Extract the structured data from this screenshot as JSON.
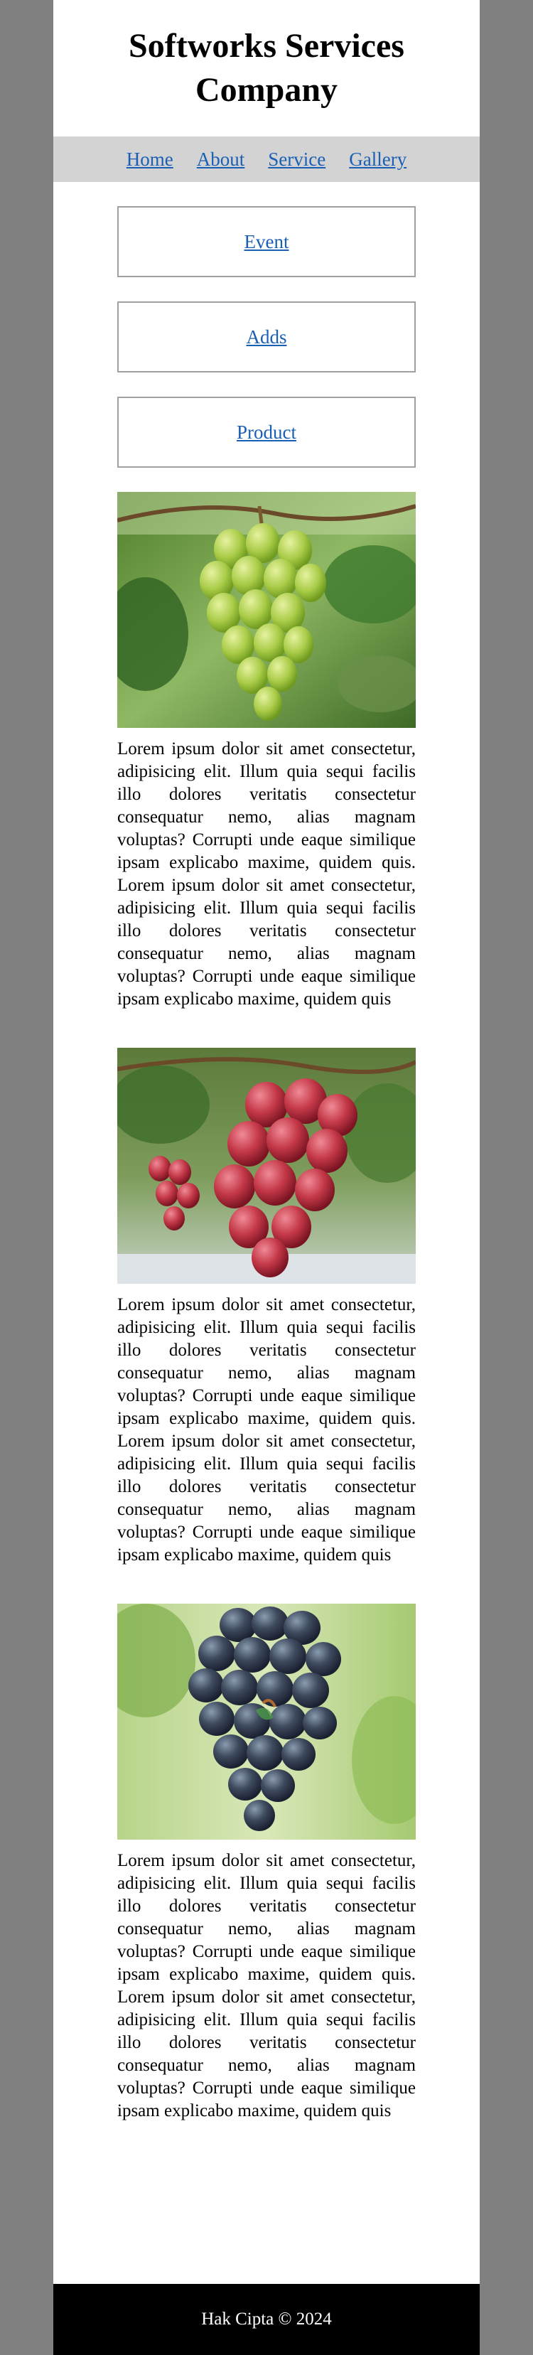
{
  "header": {
    "title_line1": "Softworks Services",
    "title_line2": "Company"
  },
  "nav": {
    "items": [
      {
        "label": "Home"
      },
      {
        "label": "About"
      },
      {
        "label": "Service"
      },
      {
        "label": "Gallery"
      }
    ]
  },
  "links": [
    {
      "label": "Event"
    },
    {
      "label": "Adds"
    },
    {
      "label": "Product"
    }
  ],
  "articles": [
    {
      "image": "green-grapes-photo",
      "text": "Lorem ipsum dolor sit amet consectetur, adipisicing elit. Illum quia sequi facilis illo dolores veritatis consectetur consequatur nemo, alias magnam voluptas? Corrupti unde eaque similique ipsam explicabo maxime, quidem quis. Lorem ipsum dolor sit amet consectetur, adipisicing elit. Illum quia sequi facilis illo dolores veritatis consectetur consequatur nemo, alias magnam voluptas? Corrupti unde eaque similique ipsam explicabo maxime, quidem quis"
    },
    {
      "image": "red-grapes-photo",
      "text": "Lorem ipsum dolor sit amet consectetur, adipisicing elit. Illum quia sequi facilis illo dolores veritatis consectetur consequatur nemo, alias magnam voluptas? Corrupti unde eaque similique ipsam explicabo maxime, quidem quis. Lorem ipsum dolor sit amet consectetur, adipisicing elit. Illum quia sequi facilis illo dolores veritatis consectetur consequatur nemo, alias magnam voluptas? Corrupti unde eaque similique ipsam explicabo maxime, quidem quis"
    },
    {
      "image": "black-grapes-photo",
      "text": "Lorem ipsum dolor sit amet consectetur, adipisicing elit. Illum quia sequi facilis illo dolores veritatis consectetur consequatur nemo, alias magnam voluptas? Corrupti unde eaque similique ipsam explicabo maxime, quidem quis. Lorem ipsum dolor sit amet consectetur, adipisicing elit. Illum quia sequi facilis illo dolores veritatis consectetur consequatur nemo, alias magnam voluptas? Corrupti unde eaque similique ipsam explicabo maxime, quidem quis"
    }
  ],
  "footer": {
    "text": "Hak Cipta © 2024"
  },
  "colors": {
    "outer_background": "#808080",
    "page_background": "#ffffff",
    "nav_background": "#d3d3d3",
    "link": "#1a5fb4",
    "footer_background": "#000000",
    "footer_text": "#ffffff"
  }
}
